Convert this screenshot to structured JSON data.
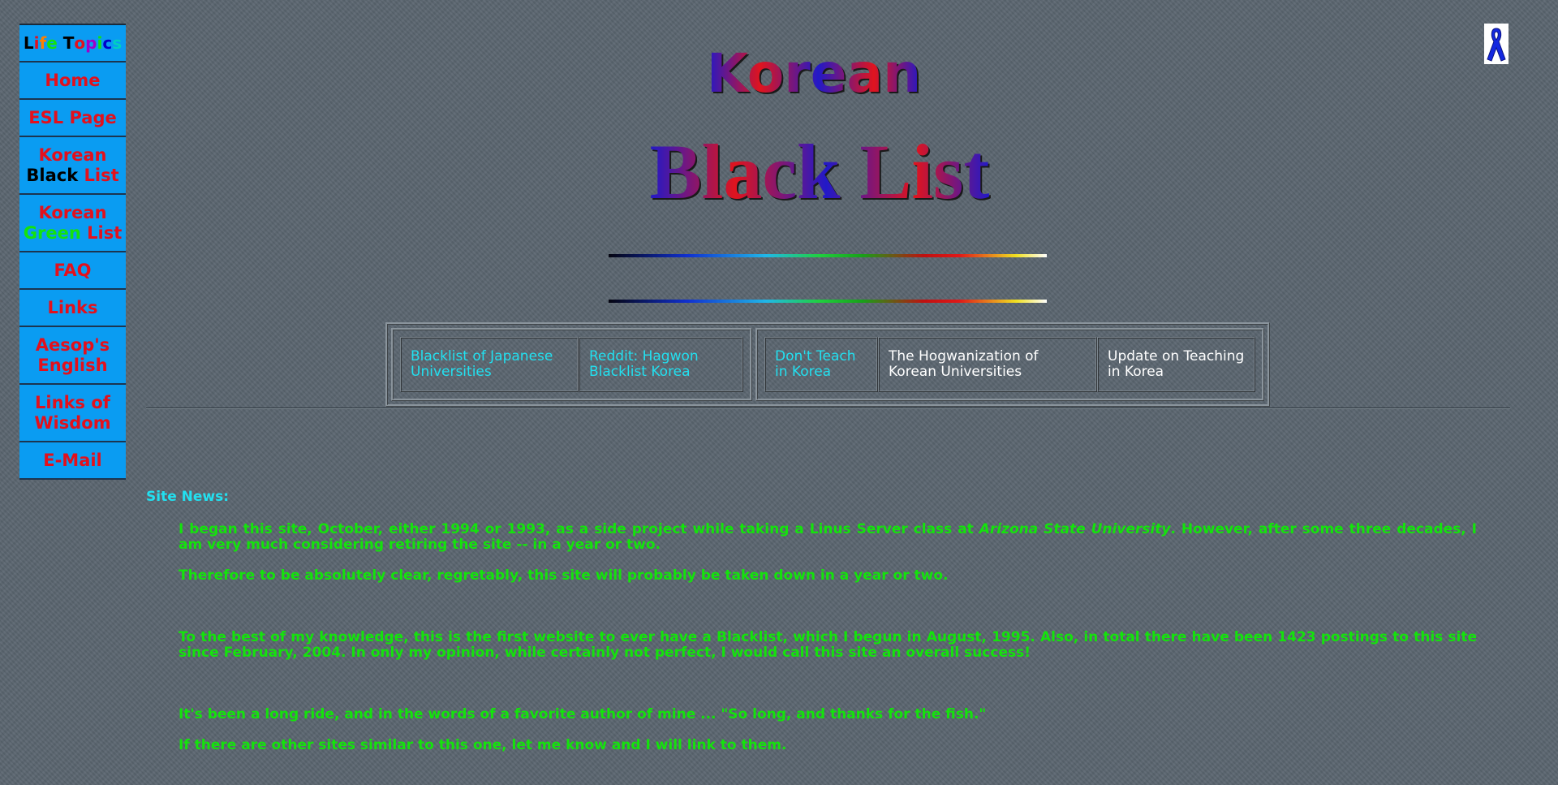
{
  "sidebar": {
    "title_parts": [
      {
        "text": "L",
        "color": "#000000"
      },
      {
        "text": "i",
        "color": "#e3101c"
      },
      {
        "text": "f",
        "color": "#ff7f00"
      },
      {
        "text": "e",
        "color": "#14e30c"
      },
      {
        "text": " ",
        "color": "#000000"
      },
      {
        "text": "T",
        "color": "#000000"
      },
      {
        "text": "o",
        "color": "#e3101c"
      },
      {
        "text": "p",
        "color": "#a000c8"
      },
      {
        "text": "i",
        "color": "#14e30c"
      },
      {
        "text": "c",
        "color": "#0000cc"
      },
      {
        "text": "s",
        "color": "#00d0c0"
      }
    ],
    "home": "Home",
    "esl": "ESL Page",
    "korean_black_1": "Korean",
    "korean_black_2": "Black",
    "korean_black_3": "List",
    "korean_green_1": "Korean",
    "korean_green_2": "Green",
    "korean_green_3": "List",
    "faq": "FAQ",
    "links": "Links",
    "aesop_1": "Aesop's",
    "aesop_2": "English",
    "wisdom_1": "Links of",
    "wisdom_2": "Wisdom",
    "email": "E-Mail"
  },
  "header": {
    "title_top": "Korean",
    "title_main": "Black List",
    "ribbon_icon": "blue-ribbon-icon"
  },
  "links": {
    "group1": [
      "Blacklist of Japanese Universities",
      "Reddit: Hagwon Blacklist Korea"
    ],
    "group2": [
      "Don't Teach in Korea",
      "The Hogwanization of Korean Universities",
      "Update on Teaching in Korea"
    ]
  },
  "news": {
    "heading": "Site News:",
    "p1_before": "I began this site, October, either 1994 or 1993, as a side project while taking a Linus Server class at ",
    "p1_em": "Arizona State University",
    "p1_after": ". However, after some three decades, I am very much considering retiring the site -- in a year or two.",
    "p2": "Therefore to be absolutely clear, regretably, this site will probably be taken down in a year or two.",
    "p3": "To the best of my knowledge, this is the first website to ever have a Blacklist, which I begun in August, 1995. Also, in total there have been 1423 postings to this site since February, 2004. In only my opinion, while certainly not perfect, I would call this site an overall success!",
    "p4": "It's been a long ride, and in the words of a favorite author of mine ... \"So long, and thanks for the fish.\"",
    "p5": "If there are other sites similar to this one, let me know and I will link to them."
  },
  "colors": {
    "background": "#5b6670",
    "sidebar_bg": "#0a9cf2",
    "sidebar_text": "#e3101c",
    "news_text": "#14e30c",
    "link_cyan": "#22e0f0",
    "link_white": "#ffffff"
  }
}
